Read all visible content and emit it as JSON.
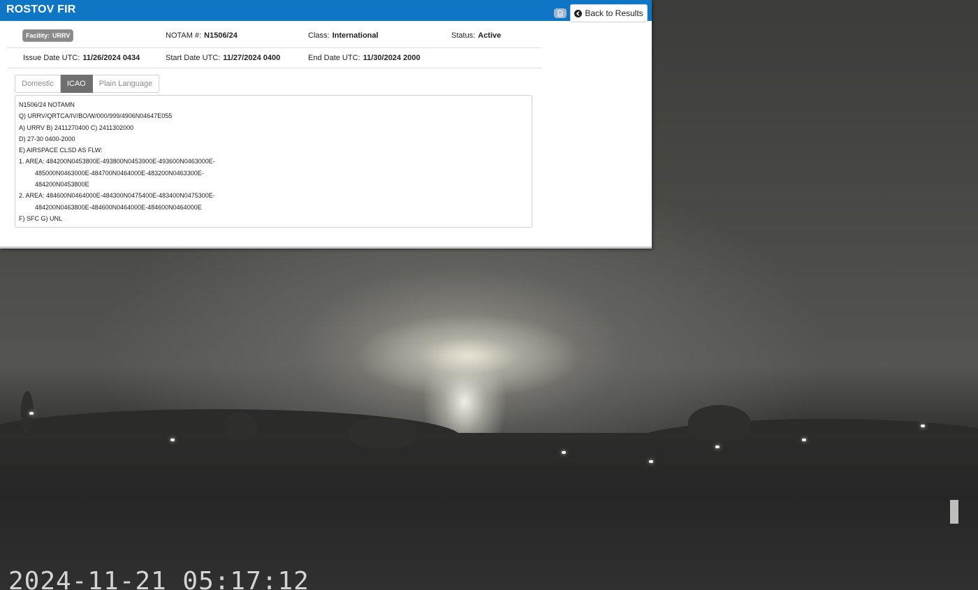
{
  "header": {
    "title": "ROSTOV FIR",
    "back_label": "Back to Results"
  },
  "info": {
    "facility_label": "Facility:",
    "facility_value": "URRV",
    "notam_label": "NOTAM #:",
    "notam_value": "N1506/24",
    "class_label": "Class:",
    "class_value": "International",
    "status_label": "Status:",
    "status_value": "Active",
    "issue_label": "Issue Date UTC:",
    "issue_value": "11/26/2024 0434",
    "start_label": "Start Date UTC:",
    "start_value": "11/27/2024 0400",
    "end_label": "End Date UTC:",
    "end_value": "11/30/2024 2000"
  },
  "tabs": [
    {
      "label": "Domestic",
      "active": false
    },
    {
      "label": "ICAO",
      "active": true
    },
    {
      "label": "Plain Language",
      "active": false
    }
  ],
  "notam_text": [
    "N1506/24 NOTAMN",
    "Q) URRV/QRTCA/IV/BO/W/000/999/4906N04647E055",
    "A) URRV B) 2411270400 C) 2411302000",
    "D) 27-30 0400-2000",
    "E) AIRSPACE CLSD AS FLW:",
    "1. AREA: 484200N0453800E-493800N0453900E-493600N0463000E-",
    "485000N0463000E-484700N0464000E-483200N0463300E-",
    "484200N0453800E",
    "2. AREA: 484600N0464000E-484300N0475400E-483400N0475300E-",
    "484200N0463800E-484600N0464000E-484600N0464000E",
    "F) SFC  G) UNL"
  ],
  "camera": {
    "timestamp": "2024-11-21 05:17:12"
  },
  "colors": {
    "header_blue": "#0f76c5",
    "active_tab": "#6f6f6f"
  }
}
